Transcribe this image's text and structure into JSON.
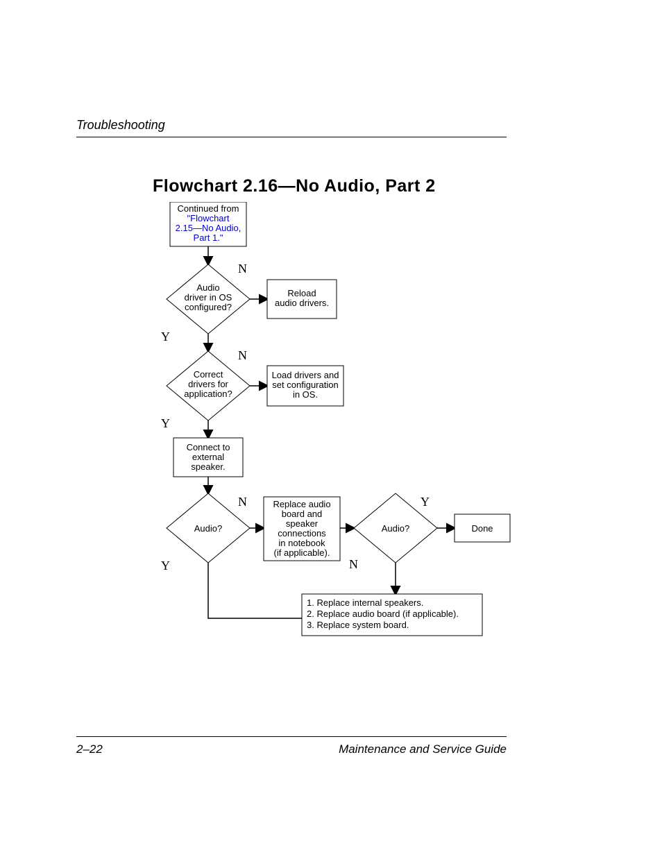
{
  "header": {
    "section": "Troubleshooting"
  },
  "title": "Flowchart 2.16—No Audio, Part 2",
  "nodes": {
    "start_l1": "Continued from",
    "start_link1": "\"Flowchart",
    "start_link2": "2.15—No Audio,",
    "start_link3": "Part 1.\"",
    "d1_l1": "Audio",
    "d1_l2": "driver in OS",
    "d1_l3": "configured?",
    "p1_l1": "Reload",
    "p1_l2": "audio drivers.",
    "d2_l1": "Correct",
    "d2_l2": "drivers for",
    "d2_l3": "application?",
    "p2_l1": "Load drivers and",
    "p2_l2": "set configuration",
    "p2_l3": "in OS.",
    "p3_l1": "Connect to",
    "p3_l2": "external",
    "p3_l3": "speaker.",
    "d3": "Audio?",
    "p4_l1": "Replace audio",
    "p4_l2": "board and",
    "p4_l3": "speaker",
    "p4_l4": "connections",
    "p4_l5": "in notebook",
    "p4_l6": "(if applicable).",
    "d4": "Audio?",
    "done": "Done",
    "p5_l1": "1. Replace internal speakers.",
    "p5_l2": "2. Replace audio board (if applicable).",
    "p5_l3": "3. Replace system board."
  },
  "labels": {
    "Y": "Y",
    "N": "N"
  },
  "footer": {
    "page": "2–22",
    "doc": "Maintenance and Service Guide"
  }
}
